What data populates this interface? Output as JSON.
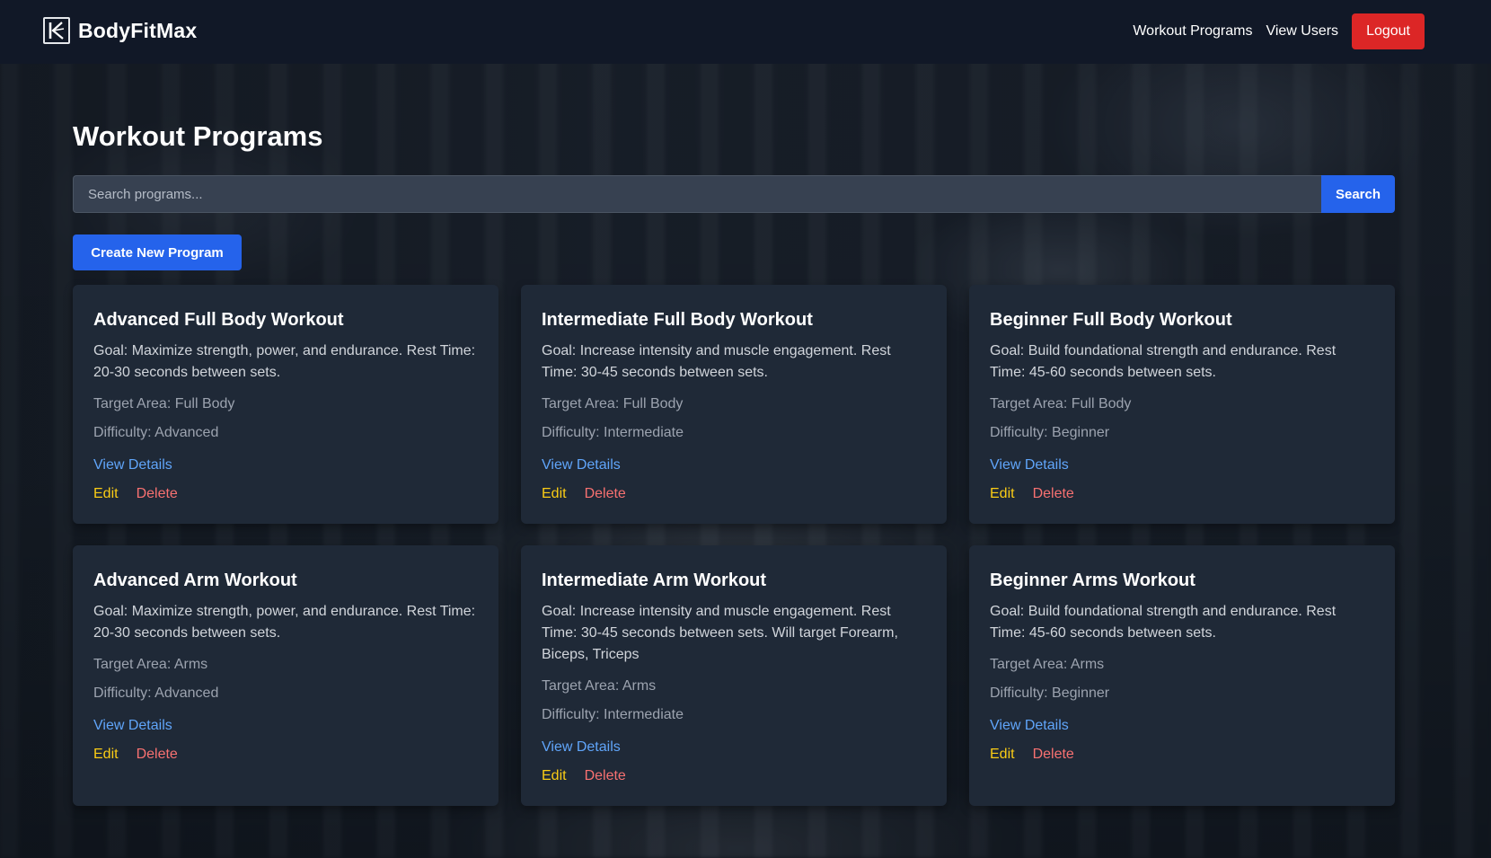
{
  "brand": {
    "name": "BodyFitMax",
    "logo_icon": "brand-logo-icon"
  },
  "nav": {
    "links": [
      "Workout Programs",
      "View Users"
    ],
    "logout_label": "Logout"
  },
  "page": {
    "title": "Workout Programs"
  },
  "search": {
    "placeholder": "Search programs...",
    "value": "",
    "button_label": "Search"
  },
  "create_button_label": "Create New Program",
  "programs": [
    {
      "title": "Advanced Full Body Workout",
      "goal": "Goal: Maximize strength, power, and endurance. Rest Time: 20-30 seconds between sets.",
      "target": "Target Area: Full Body",
      "difficulty": "Difficulty: Advanced",
      "details_label": "View Details",
      "edit_label": "Edit",
      "delete_label": "Delete"
    },
    {
      "title": "Intermediate Full Body Workout",
      "goal": "Goal: Increase intensity and muscle engagement. Rest Time: 30-45 seconds between sets.",
      "target": "Target Area: Full Body",
      "difficulty": "Difficulty: Intermediate",
      "details_label": "View Details",
      "edit_label": "Edit",
      "delete_label": "Delete"
    },
    {
      "title": "Beginner Full Body Workout",
      "goal": "Goal: Build foundational strength and endurance. Rest Time: 45-60 seconds between sets.",
      "target": "Target Area: Full Body",
      "difficulty": "Difficulty: Beginner",
      "details_label": "View Details",
      "edit_label": "Edit",
      "delete_label": "Delete"
    },
    {
      "title": "Advanced Arm Workout",
      "goal": "Goal: Maximize strength, power, and endurance. Rest Time: 20-30 seconds between sets.",
      "target": "Target Area: Arms",
      "difficulty": "Difficulty: Advanced",
      "details_label": "View Details",
      "edit_label": "Edit",
      "delete_label": "Delete"
    },
    {
      "title": "Intermediate Arm Workout",
      "goal": "Goal: Increase intensity and muscle engagement. Rest Time: 30-45 seconds between sets. Will target Forearm, Biceps, Triceps",
      "target": "Target Area: Arms",
      "difficulty": "Difficulty: Intermediate",
      "details_label": "View Details",
      "edit_label": "Edit",
      "delete_label": "Delete"
    },
    {
      "title": "Beginner Arms Workout",
      "goal": "Goal: Build foundational strength and endurance. Rest Time: 45-60 seconds between sets.",
      "target": "Target Area: Arms",
      "difficulty": "Difficulty: Beginner",
      "details_label": "View Details",
      "edit_label": "Edit",
      "delete_label": "Delete"
    }
  ],
  "colors": {
    "accent": "#2563eb",
    "danger": "#dc2626",
    "edit": "#facc15",
    "delete": "#f87171",
    "link": "#60a5fa",
    "card": "#1f2937",
    "navbar": "#111827"
  }
}
